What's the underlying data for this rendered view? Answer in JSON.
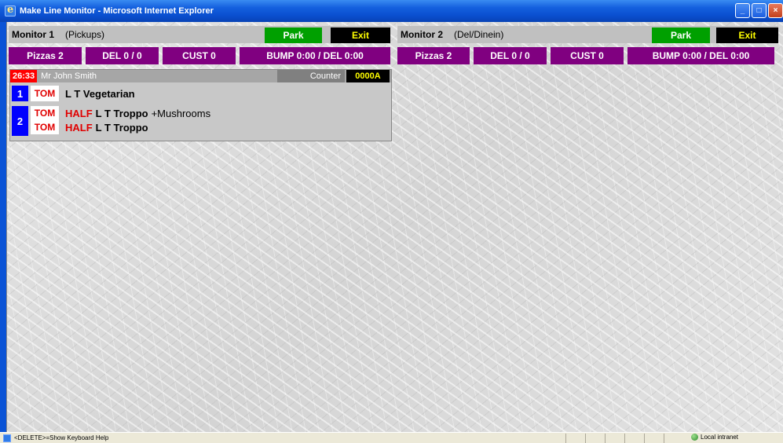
{
  "window": {
    "title": "Make Line Monitor - Microsoft Internet Explorer",
    "buttons": {
      "minimize": "_",
      "maximize": "□",
      "close": "×"
    }
  },
  "monitors": [
    {
      "name": "Monitor 1",
      "type": "(Pickups)",
      "park_label": "Park",
      "exit_label": "Exit",
      "stats": {
        "pizzas": "Pizzas 2",
        "del": "DEL 0 / 0",
        "cust": "CUST 0",
        "bump": "BUMP 0:00 / DEL 0:00"
      }
    },
    {
      "name": "Monitor 2",
      "type": "(Del/Dinein)",
      "park_label": "Park",
      "exit_label": "Exit",
      "stats": {
        "pizzas": "Pizzas 2",
        "del": "DEL 0 / 0",
        "cust": "CUST 0",
        "bump": "BUMP 0:00 / DEL 0:00"
      }
    }
  ],
  "order": {
    "timer": "26:33",
    "customer": "Mr John Smith",
    "source": "Counter",
    "code": "0000A",
    "items": [
      {
        "number": "1",
        "lines": [
          {
            "tag": "TOM",
            "half": "",
            "desc": "L T Vegetarian",
            "extra": ""
          }
        ]
      },
      {
        "number": "2",
        "lines": [
          {
            "tag": "TOM",
            "half": "HALF",
            "desc": "L T Troppo",
            "extra": "+Mushrooms"
          },
          {
            "tag": "TOM",
            "half": "HALF",
            "desc": "L T Troppo",
            "extra": ""
          }
        ]
      }
    ]
  },
  "status_bar": {
    "hint": "<DELETE>=Show Keyboard Help",
    "zone": "Local intranet"
  },
  "colors": {
    "stat_bg": "#800080",
    "park_bg": "#00a000",
    "exit_bg": "#000000",
    "exit_fg": "#ffff00",
    "timer_bg": "#ff0000",
    "item_number_bg": "#0000ff"
  }
}
